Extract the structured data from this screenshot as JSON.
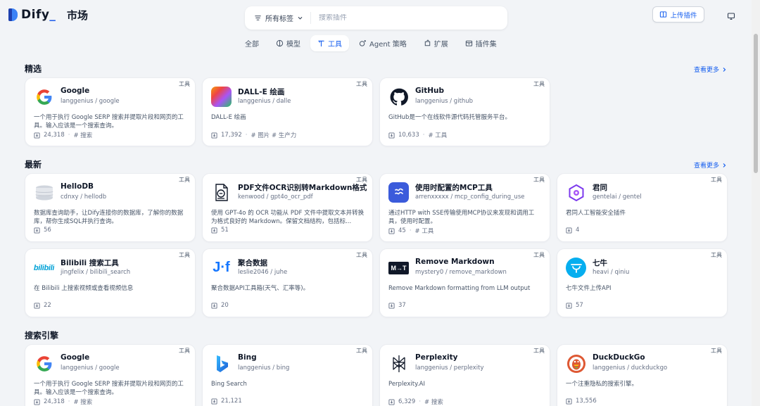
{
  "header": {
    "logo_text": "Dify",
    "title": "市场",
    "tag_filter_label": "所有标签",
    "search_placeholder": "搜索插件",
    "upload_label": "上传插件"
  },
  "tabs": [
    {
      "label": "全部",
      "icon": "none",
      "active": false
    },
    {
      "label": "模型",
      "icon": "model-icon",
      "active": false
    },
    {
      "label": "工具",
      "icon": "tool-icon",
      "active": true
    },
    {
      "label": "Agent 策略",
      "icon": "agent-icon",
      "active": false
    },
    {
      "label": "扩展",
      "icon": "extension-icon",
      "active": false
    },
    {
      "label": "插件集",
      "icon": "bundle-icon",
      "active": false
    }
  ],
  "sections": {
    "featured": {
      "title": "精选",
      "more": "查看更多"
    },
    "latest": {
      "title": "最新",
      "more": "查看更多"
    },
    "search": {
      "title": "搜索引擎"
    }
  },
  "featured_cards": [
    {
      "name": "Google",
      "org": "langgenius / google",
      "badge": "工具",
      "icon": "google-logo",
      "desc": "一个用于执行 Google SERP 搜索并提取片段和网页的工具。输入应该是一个搜索查询。",
      "installs": "24,318",
      "tags": "# 搜索"
    },
    {
      "name": "DALL-E 绘画",
      "org": "langgenius / dalle",
      "badge": "工具",
      "icon": "dalle-logo",
      "desc": "DALL-E 绘画",
      "installs": "17,392",
      "tags": "# 图片  # 生产力"
    },
    {
      "name": "GitHub",
      "org": "langgenius / github",
      "badge": "工具",
      "icon": "github-logo",
      "desc": "GitHub是一个在线软件源代码托管服务平台。",
      "installs": "10,633",
      "tags": "# 工具"
    }
  ],
  "latest_cards": [
    {
      "name": "HelloDB",
      "org": "cdnxy / hellodb",
      "badge": "工具",
      "icon": "database-logo",
      "desc": "数据库查询助手，让Dify连接你的数据库，了解你的数据库，帮你生成SQL并执行查询。",
      "installs": "56",
      "tags": ""
    },
    {
      "name": "PDF文件OCR识别转Markdown格式",
      "org": "kenwood / gpt4o_ocr_pdf",
      "badge": "工具",
      "icon": "pdf-ocr-logo",
      "desc": "使用 GPT-4o 的 OCR 功能从 PDF 文件中提取文本并转换为格式良好的 Markdown。保留文档结构，包括标...",
      "installs": "51",
      "tags": ""
    },
    {
      "name": "使用时配置的MCP工具",
      "org": "arrenxxxxx / mcp_config_during_use",
      "badge": "工具",
      "icon": "mcp-logo",
      "desc": "通过HTTP with SSE传输使用MCP协议来发现和调用工具，使用时配置。",
      "installs": "45",
      "tags": "# 工具"
    },
    {
      "name": "君同",
      "org": "gentelai / gentel",
      "badge": "工具",
      "icon": "gentel-logo",
      "desc": "君同人工智能安全插件",
      "installs": "4",
      "tags": ""
    },
    {
      "name": "Bilibili 搜索工具",
      "org": "jingfelix / bilibili_search",
      "badge": "工具",
      "icon": "bilibili-logo",
      "desc": "在 Bilibili 上搜索视频或查看视频信息",
      "installs": "22",
      "tags": ""
    },
    {
      "name": "聚合数据",
      "org": "leslie2046 / juhe",
      "badge": "工具",
      "icon": "juhe-logo",
      "desc": "聚合数据API工具箱(天气、汇率等)。",
      "installs": "20",
      "tags": ""
    },
    {
      "name": "Remove Markdown",
      "org": "mystery0 / remove_markdown",
      "badge": "工具",
      "icon": "markdown-logo",
      "desc": "Remove Markdown formatting from LLM output",
      "installs": "37",
      "tags": ""
    },
    {
      "name": "七牛",
      "org": "heavi / qiniu",
      "badge": "工具",
      "icon": "qiniu-logo",
      "desc": "七牛文件上传API",
      "installs": "57",
      "tags": ""
    }
  ],
  "search_cards": [
    {
      "name": "Google",
      "org": "langgenius / google",
      "badge": "工具",
      "icon": "google-logo",
      "desc": "一个用于执行 Google SERP 搜索并提取片段和网页的工具。输入应该是一个搜索查询。",
      "installs": "24,318",
      "tags": "# 搜索"
    },
    {
      "name": "Bing",
      "org": "langgenius / bing",
      "badge": "工具",
      "icon": "bing-logo",
      "desc": "Bing Search",
      "installs": "21,121",
      "tags": ""
    },
    {
      "name": "Perplexity",
      "org": "langgenius / perplexity",
      "badge": "工具",
      "icon": "perplexity-logo",
      "desc": "Perplexity.AI",
      "installs": "6,329",
      "tags": "# 搜索"
    },
    {
      "name": "DuckDuckGo",
      "org": "langgenius / duckduckgo",
      "badge": "工具",
      "icon": "duckduckgo-logo",
      "desc": "一个注重隐私的搜索引擎。",
      "installs": "13,556",
      "tags": ""
    }
  ]
}
